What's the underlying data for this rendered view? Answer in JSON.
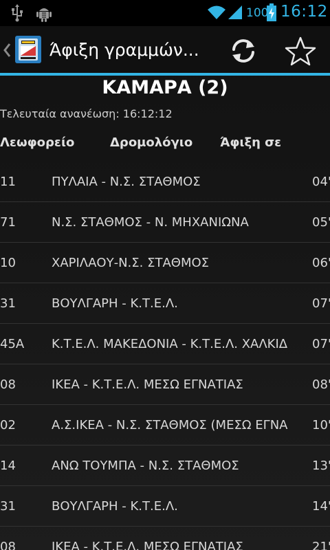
{
  "status_bar": {
    "battery": "100",
    "time": "16:12",
    "accent_color": "#33b5e5",
    "icons": [
      "usb-icon",
      "android-debug-icon",
      "wifi-icon",
      "signal-icon",
      "battery-charging-icon"
    ]
  },
  "action_bar": {
    "title": "Άφιξη γραμμών...",
    "icons": [
      "up-caret-icon",
      "app-icon",
      "refresh-icon",
      "star-icon"
    ]
  },
  "header": {
    "stop_name": "ΚΑΜΑΡΑ (2)",
    "last_update": "Τελευταία ανανέωση: 16:12:12"
  },
  "columns": {
    "bus": "Λεωφορείο",
    "route": "Δρομολόγιο",
    "arrival": "Άφιξη σε"
  },
  "arrivals": [
    {
      "bus": "11",
      "route": "ΠΥΛΑΙΑ - Ν.Σ. ΣΤΑΘΜΟΣ",
      "arrival": "04'"
    },
    {
      "bus": "71",
      "route": "Ν.Σ. ΣΤΑΘΜΟΣ - Ν. ΜΗΧΑΝΙΩΝΑ",
      "arrival": "05'"
    },
    {
      "bus": "10",
      "route": "ΧΑΡΙΛΑΟΥ-Ν.Σ. ΣΤΑΘΜΟΣ",
      "arrival": "06'"
    },
    {
      "bus": "31",
      "route": "ΒΟΥΛΓΑΡΗ - Κ.Τ.Ε.Λ.",
      "arrival": "07'"
    },
    {
      "bus": "45Α",
      "route": "Κ.Τ.Ε.Λ. ΜΑΚΕΔΟΝΙΑ - Κ.Τ.Ε.Λ. ΧΑΛΚΙΔ",
      "arrival": "07'"
    },
    {
      "bus": "08",
      "route": "ΙΚΕΑ - Κ.Τ.Ε.Λ. ΜΕΣΩ ΕΓΝΑΤΙΑΣ",
      "arrival": "08'"
    },
    {
      "bus": "02",
      "route": "Α.Σ.ΙΚΕΑ - Ν.Σ. ΣΤΑΘΜΟΣ (ΜΕΣΩ ΕΓΝΑ",
      "arrival": "10'"
    },
    {
      "bus": "14",
      "route": "ΑΝΩ ΤΟΥΜΠΑ - Ν.Σ. ΣΤΑΘΜΟΣ",
      "arrival": "13'"
    },
    {
      "bus": "31",
      "route": "ΒΟΥΛΓΑΡΗ - Κ.Τ.Ε.Λ.",
      "arrival": "14'"
    },
    {
      "bus": "08",
      "route": "ΙΚΕΑ - Κ.Τ.Ε.Λ. ΜΕΣΩ ΕΓΝΑΤΙΑΣ",
      "arrival": "21'"
    }
  ]
}
